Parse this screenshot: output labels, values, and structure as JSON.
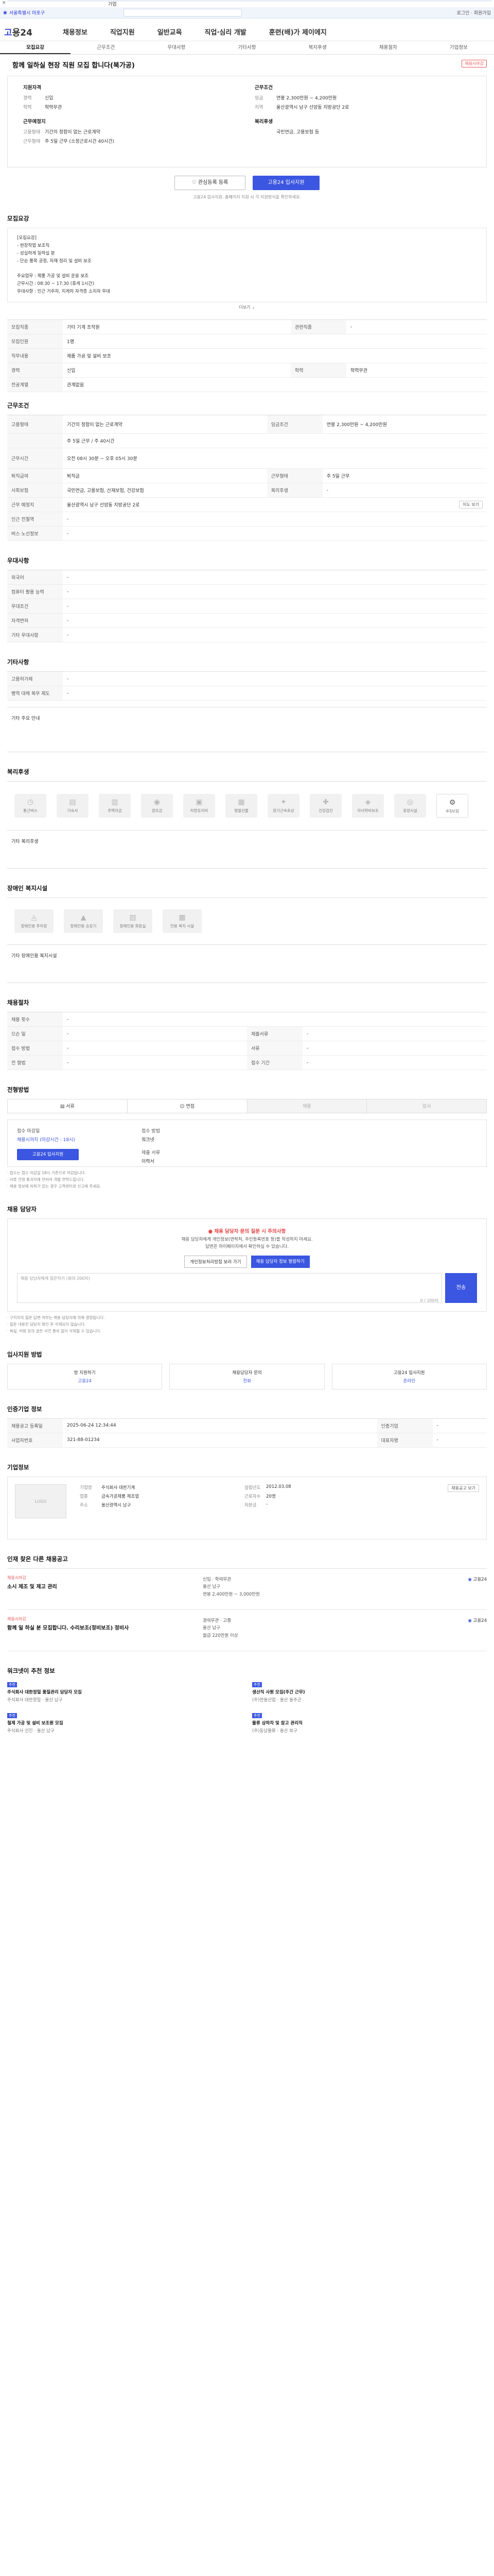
{
  "strip": {
    "label": "기업"
  },
  "search": {
    "left_label": "서울특별시 마포구",
    "placeholder": "",
    "right": "로그인 · 회원가입"
  },
  "brand": {
    "a": "고",
    "b": "용24"
  },
  "nav": [
    "채용정보",
    "직업지원",
    "일반교육",
    "직업·심리 개발",
    "훈련(배)가 제이에지"
  ],
  "subtabs": [
    "모집요강",
    "근무조건",
    "우대사항",
    "기타사항",
    "복지후생",
    "채용절차",
    "기업정보"
  ],
  "job": {
    "title": "함께 일하실 현장 직원 모집 합니다(북가공)",
    "badge": "채용시마감"
  },
  "summary": {
    "left_title": "지원자격",
    "left": [
      {
        "k": "경력",
        "v": "신입"
      },
      {
        "k": "학력",
        "v": "학력무관"
      }
    ],
    "left2_title": "근무예정지",
    "left2": [
      {
        "k": "고용형태",
        "v": "기간의 정함이 없는 근로계약"
      },
      {
        "k": "근무형태",
        "v": "주 5일 근무 (소정근로시간 40시간)"
      }
    ],
    "right_title": "근무조건",
    "right": [
      {
        "k": "임금",
        "v": "연봉 2,300만원 ~ 4,200만원"
      },
      {
        "k": "지역",
        "v": "울산광역시 남구 선암동 지방공단 2로"
      }
    ],
    "right2_title": "복리후생",
    "right2": [
      {
        "k": "",
        "v": "국민연금, 고용보험 등"
      }
    ]
  },
  "actions": {
    "favorite": "관심등록 등록",
    "apply": "고용24 입사지원"
  },
  "notice": "고용24 입사지원, 홈페이지 지원 시 각 지원방식을 확인하세요.",
  "sec_recruit": "모집요강",
  "detail": {
    "lines": [
      "[모집요강]",
      "- 현장작업 보조직",
      "- 성실하게 일하실 분",
      "- 단순 품목 공정, 자재 정리 및 설비 보조",
      "",
      "주요업무 : 제품 가공 및 설비 운용 보조",
      "근무시간 : 08:30 ~ 17:30 (휴게 1시간)",
      "우대사항 : 인근 거주자, 지게차 자격증 소지자 우대"
    ],
    "more": "더보기"
  },
  "recruit_table": [
    {
      "k": "모집직종",
      "v": "기타 기계 조작원",
      "k2": "관련직종",
      "v2": "-"
    },
    {
      "k": "모집인원",
      "v": "1명",
      "k2": "",
      "v2": ""
    },
    {
      "k": "직무내용",
      "v": "제품 가공 및 설비 보조",
      "k2": "",
      "v2": ""
    },
    {
      "k": "경력",
      "v": "신입",
      "k2": "학력",
      "v2": "학력무관"
    },
    {
      "k": "전공계열",
      "v": "관계없음",
      "k2": "",
      "v2": ""
    }
  ],
  "sec_condition": "근무조건",
  "condition_table": [
    {
      "k": "고용형태",
      "v": "기간의 정함이 없는 근로계약",
      "k2": "임금조건",
      "v2": "연봉 2,300만원 ~ 4,200만원"
    },
    {
      "k": "",
      "v": "주 5일 근무 / 주 40시간",
      "k2": "",
      "v2": ""
    },
    {
      "k": "근무시간",
      "v": "오전 08시 30분 ~ 오후 05시 30분",
      "k2": "",
      "v2": ""
    },
    {
      "k": "퇴직급여",
      "v": "퇴직금",
      "k2": "근무형태",
      "v2": "주 5일 근무"
    },
    {
      "k": "사회보험",
      "v": "국민연금, 고용보험, 산재보험, 건강보험",
      "k2": "복리후생",
      "v2": "-"
    },
    {
      "k": "근무 예정지",
      "v": "울산광역시 남구 선암동 지방공단 2로",
      "k2": "",
      "v2": ""
    },
    {
      "k": "인근 전철역",
      "v": "-",
      "k2": "",
      "v2": ""
    },
    {
      "k": "버스 노선정보",
      "v": "-",
      "k2": "",
      "v2": ""
    }
  ],
  "map_btn": "지도 보기",
  "sec_pref": "우대사항",
  "pref_table": [
    {
      "k": "외국어",
      "v": "-"
    },
    {
      "k": "컴퓨터 활용 능력",
      "v": "-"
    },
    {
      "k": "우대조건",
      "v": "-"
    },
    {
      "k": "자격면허",
      "v": "-"
    },
    {
      "k": "기타 우대사항",
      "v": "-"
    }
  ],
  "sec_etc": "기타사항",
  "etc_table": [
    {
      "k": "고용허가제",
      "v": "-"
    },
    {
      "k": "병역 대체 복무 제도",
      "v": "-"
    }
  ],
  "etc_note": "기타 주요 안내",
  "sec_welfare": "복리후생",
  "welfare_icons": [
    {
      "icon": "clock-icon",
      "glyph": "◷",
      "label": "통근버스"
    },
    {
      "icon": "meal-icon",
      "glyph": "▤",
      "label": "기숙사"
    },
    {
      "icon": "house-icon",
      "glyph": "▥",
      "label": "주택자금"
    },
    {
      "icon": "coin-icon",
      "glyph": "◉",
      "label": "경조금"
    },
    {
      "icon": "car-icon",
      "glyph": "▣",
      "label": "차량유지비"
    },
    {
      "icon": "gift-icon",
      "glyph": "▦",
      "label": "명절선물"
    },
    {
      "icon": "medal-icon",
      "glyph": "✦",
      "label": "장기근속포상"
    },
    {
      "icon": "health-icon",
      "glyph": "✚",
      "label": "건강검진"
    },
    {
      "icon": "edu-icon",
      "glyph": "◈",
      "label": "자녀학비보조"
    },
    {
      "icon": "rest-icon",
      "glyph": "◎",
      "label": "휴양시설"
    },
    {
      "icon": "tools-icon",
      "glyph": "⚙",
      "label": "4대보험"
    }
  ],
  "welfare_note": "기타 복리후생",
  "sec_disabled": "장애인 복지시설",
  "disabled_icons": [
    {
      "icon": "ramp-icon",
      "glyph": "◬",
      "label": "장애인용 주차장"
    },
    {
      "icon": "elevator-icon",
      "glyph": "▲",
      "label": "장애인용 승강기"
    },
    {
      "icon": "toilet-icon",
      "glyph": "▨",
      "label": "장애인용 화장실"
    },
    {
      "icon": "door-icon",
      "glyph": "▩",
      "label": "전용 복지 시설"
    }
  ],
  "disabled_note": "기타 장애인용 복지시설",
  "sec_process": "채용절차",
  "process_table": [
    {
      "k": "채용 횟수",
      "v": "-"
    },
    {
      "k": "으슨 일",
      "v": "-",
      "k2": "제출서류",
      "v2": "-"
    },
    {
      "k": "접수 방법",
      "v": "-",
      "k2": "서류",
      "v2": "-"
    },
    {
      "k": "전 형법",
      "v": "-",
      "k2": "접수 기간",
      "v2": "-"
    }
  ],
  "sec_apply": "전형방법",
  "process_steps": [
    "서류",
    "면접",
    "채용",
    "입사"
  ],
  "apply_box": {
    "k1": "접수 마감일",
    "v1": "채용시까지 (마감시간 : 18시)",
    "k2": "접수 방법",
    "v2": "워크넷",
    "k3": "제출 서류",
    "v3": "이력서",
    "btn": "고용24 입사지원"
  },
  "apply_notes": [
    "· 접수는 접수 마감일 18시 기준으로 마감됩니다.",
    "· 서류 전형 통과자에 한하여 개별 연락드립니다.",
    "· 채용 정보에 허위가 있는 경우 고객센터로 신고해 주세요."
  ],
  "sec_qna": "채용 담당자",
  "qna": {
    "alert": "● 채용 담당자 문의 질문 시 주의사항",
    "sub1": "채용 담당자에게 개인정보(연락처, 주민등록번호 등)를 작성하지 마세요.",
    "sub2": "답변은 마이페이지에서 확인하실 수 있습니다.",
    "b1": "개인정보처리방침 보러 가기",
    "b2": "채용 담당자 정보 열람하기",
    "placeholder": "채용 담당자에게 질문하기 (최대 200자)",
    "send": "전송",
    "count": "0 / 200자"
  },
  "qna_bullets": [
    "· 구직자의 질문 답변 여부는 채용 담당자에 의해 결정됩니다.",
    "· 질문 내용은 담당자 확인 후 삭제되지 않습니다.",
    "· 욕설, 비방 등의 글은 사전 통보 없이 삭제될 수 있습니다."
  ],
  "sec_contact": "입사지원 방법",
  "contacts": [
    {
      "t": "방 지원하기",
      "v": "고용24"
    },
    {
      "t": "채용담당자 문의",
      "v": "전화"
    },
    {
      "t": "고용24 입사지원",
      "v": "온라인"
    }
  ],
  "sec_info": "인증기업 정보",
  "info_table": [
    {
      "k": "채용공고 등록일",
      "v": "2025-06-24 12:34:44",
      "k2": "인증기업",
      "v2": "-"
    },
    {
      "k": "사업자번호",
      "v": "321-88-01234",
      "k2": "대표자명",
      "v2": "-"
    }
  ],
  "sec_company": "기업정보",
  "company": {
    "logo": "LOGO",
    "k1": "기업명",
    "v1": "주식회사 대한기계",
    "k2": "업종",
    "v2": "금속가공제품 제조업",
    "k3": "주소",
    "v3": "울산광역시 남구",
    "k4": "설립년도",
    "v4": "2012.03.08",
    "k5": "근로자수",
    "v5": "20명",
    "k6": "자본금",
    "v6": "-",
    "btn": "채용공고 보기"
  },
  "sec_related": "인재 찾은 다른 채용공고",
  "related": [
    {
      "tag": "채용시마감",
      "title": "소시 제조 및 제고 관리",
      "meta1": "신입 · 학력무관",
      "meta2": "울산 남구",
      "meta3": "연봉 2,400만원 ~ 3,000만원",
      "right": "고용24"
    },
    {
      "tag": "채용시마감",
      "title": "함께 일 하실 분 모집합니다. 수리보조(정비보조) 정비사",
      "meta1": "경력무관 · 고졸",
      "meta2": "울산 남구",
      "meta3": "월급 220만원 이상",
      "right": "고용24"
    }
  ],
  "sec_rec": "워크넷이 추천 정보",
  "rec": [
    {
      "tag": "추천",
      "t": "주식회사 대한정밀 품질관리 담당자 모집",
      "co": "주식회사 대한정밀 · 울산 남구"
    },
    {
      "tag": "추천",
      "t": "생산직 사원 모집(주간 근무)",
      "co": "(주)한울산업 · 울산 울주군"
    },
    {
      "tag": "추천",
      "t": "철제 가공 및 설비 보조원 모집",
      "co": "주식회사 선진 · 울산 남구"
    },
    {
      "tag": "추천",
      "t": "물류 상하차 및 창고 관리직",
      "co": "(주)동남물류 · 울산 북구"
    }
  ]
}
